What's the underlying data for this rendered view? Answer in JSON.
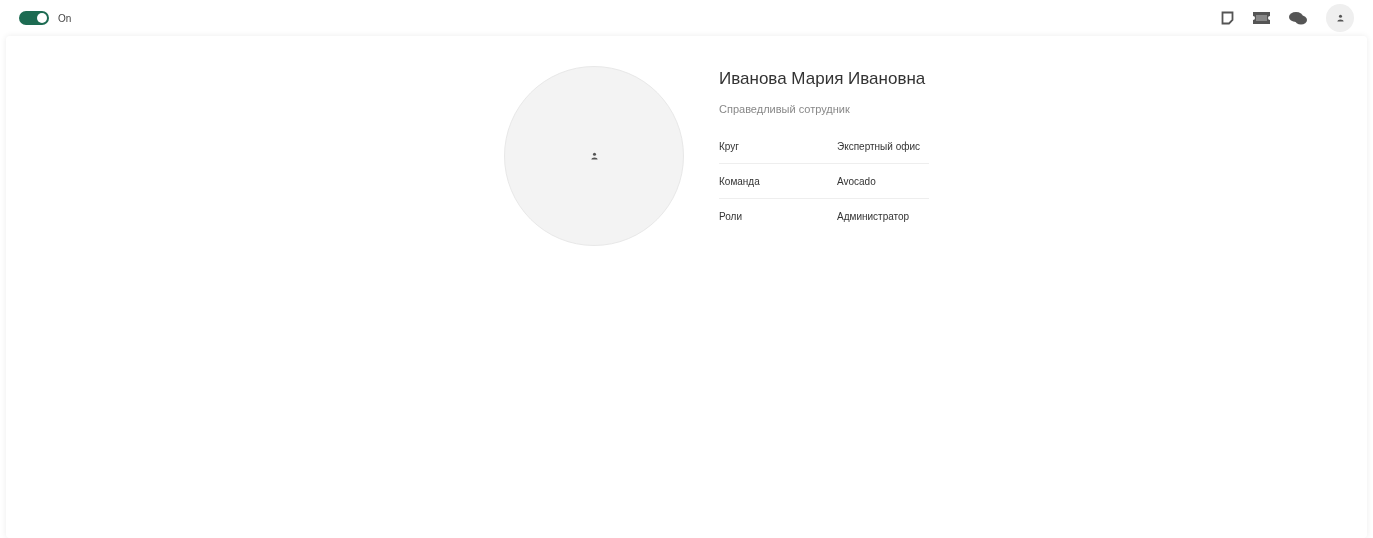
{
  "header": {
    "toggle": {
      "label": "On",
      "on": true
    }
  },
  "profile": {
    "name": "Иванова Мария Ивановна",
    "subtitle": "Справедливый сотрудник",
    "fields": [
      {
        "label": "Круг",
        "value": "Экспертный офис"
      },
      {
        "label": "Команда",
        "value": "Avocado"
      },
      {
        "label": "Роли",
        "value": "Администратор"
      }
    ]
  }
}
